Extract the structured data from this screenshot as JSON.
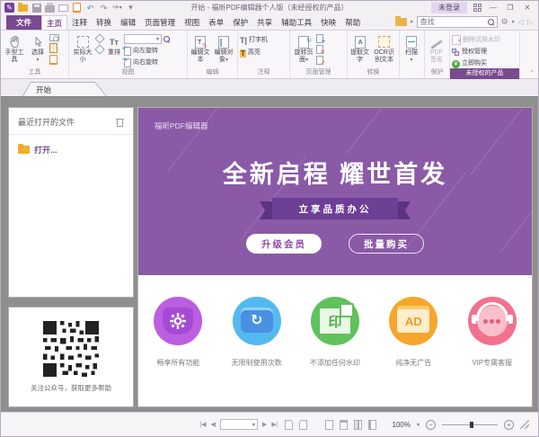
{
  "titlebar": {
    "title": "开始 - 福昕PDF编辑器个人版（未经授权的产品）",
    "login": "未登录"
  },
  "menubar": {
    "file": "文件",
    "tabs": [
      "主页",
      "注释",
      "转换",
      "编辑",
      "页面管理",
      "视图",
      "表单",
      "保护",
      "共享",
      "辅助工具",
      "快映",
      "帮助"
    ],
    "active_tab": "主页",
    "search_placeholder": "查找"
  },
  "ribbon": {
    "tools": {
      "label": "工具",
      "hand": "手型工具",
      "select": "选择"
    },
    "view": {
      "label": "视图",
      "actual_size": "实际大小",
      "reflow": "重排",
      "rotate_left": "向左旋转",
      "rotate_right": "向右旋转",
      "zoom_value": ""
    },
    "edit": {
      "label": "编辑",
      "edit_text": "编辑文本",
      "edit_object": "编辑对象"
    },
    "comment": {
      "label": "注释",
      "typewriter": "打字机",
      "highlight": "高亮"
    },
    "pages": {
      "label": "页面管理",
      "rotate_pages": "旋转页面"
    },
    "convert": {
      "label": "转换",
      "extract_text": "提取文字",
      "ocr": "OCR识别文本"
    },
    "scan": {
      "button": "扫描"
    },
    "protect": {
      "label": "保护",
      "pdf_sign": "PDF签名"
    },
    "unlicensed": {
      "label": "未授权的产品",
      "remove_watermark": "删除试用水印",
      "license_manage": "授权管理",
      "buy_now": "立即购买"
    }
  },
  "doc_tab": "开始",
  "sidebar": {
    "recent_header": "最近打开的文件",
    "open_label": "打开...",
    "qr_caption": "关注公众号，获取更多帮助"
  },
  "banner": {
    "brand": "福昕PDF编辑器",
    "headline": "全新启程 耀世首发",
    "badge": "立享品质办公",
    "upgrade_button": "升级会员",
    "bulk_button": "批量购买",
    "bg_color": "#8a5aa6",
    "badge_color": "#6d3f95"
  },
  "features": [
    {
      "label": "畅享所有功能",
      "color": "#bb5fe0"
    },
    {
      "label": "无限制使用次数",
      "color": "#54b9ef"
    },
    {
      "label": "不添加任何水印",
      "color": "#5fc25a"
    },
    {
      "label": "纯净无广告",
      "color": "#f6a62c"
    },
    {
      "label": "VIP专属客服",
      "color": "#f2718e"
    }
  ],
  "statusbar": {
    "zoom_level": "100%"
  },
  "feature_icon_ad_text": "AD",
  "feature_icon_stamp_text": "印"
}
